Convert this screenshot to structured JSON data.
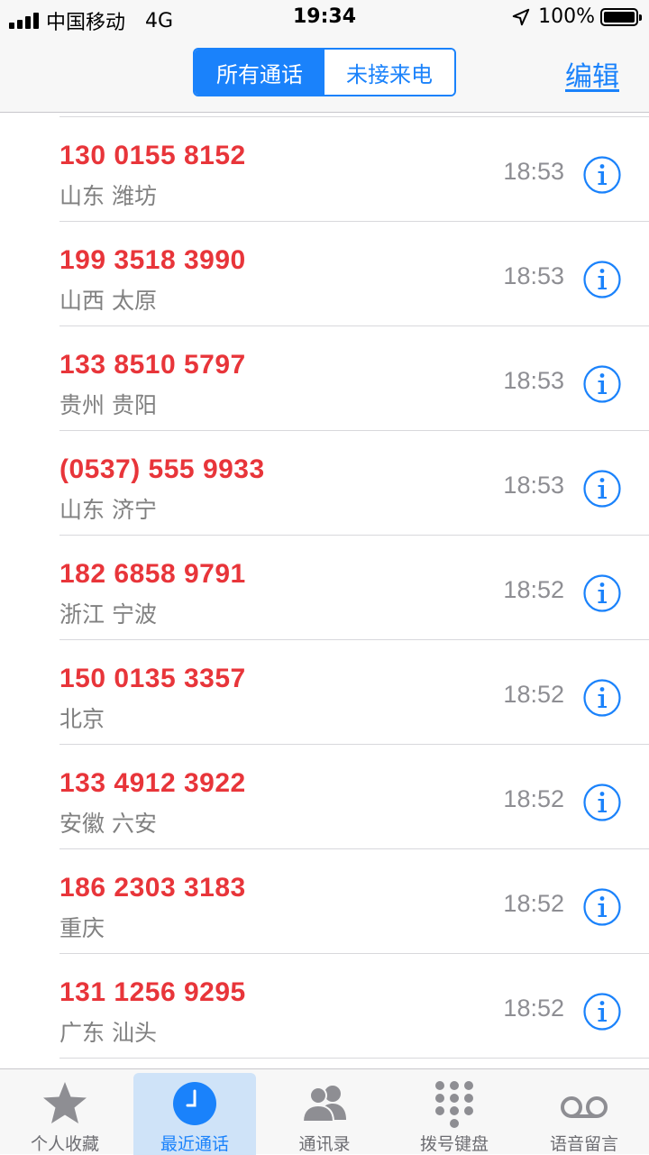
{
  "status_bar": {
    "carrier": "中国移动",
    "network": "4G",
    "time": "19:34",
    "battery": "100%"
  },
  "nav": {
    "segments": [
      "所有通话",
      "未接来电"
    ],
    "active_segment": 0,
    "edit_label": "编辑"
  },
  "calls": [
    {
      "number": "130 0155 8152",
      "location": "山东 潍坊",
      "time": "18:53"
    },
    {
      "number": "199 3518 3990",
      "location": "山西 太原",
      "time": "18:53"
    },
    {
      "number": "133 8510 5797",
      "location": "贵州 贵阳",
      "time": "18:53"
    },
    {
      "number": "(0537) 555 9933",
      "location": "山东 济宁",
      "time": "18:53"
    },
    {
      "number": "182 6858 9791",
      "location": "浙江 宁波",
      "time": "18:52"
    },
    {
      "number": "150 0135 3357",
      "location": "北京",
      "time": "18:52"
    },
    {
      "number": "133 4912 3922",
      "location": "安徽 六安",
      "time": "18:52"
    },
    {
      "number": "186 2303 3183",
      "location": "重庆",
      "time": "18:52"
    },
    {
      "number": "131 1256 9295",
      "location": "广东 汕头",
      "time": "18:52"
    }
  ],
  "tabs": [
    {
      "label": "个人收藏",
      "icon": "star-icon"
    },
    {
      "label": "最近通话",
      "icon": "clock-icon"
    },
    {
      "label": "通讯录",
      "icon": "contacts-icon"
    },
    {
      "label": "拨号键盘",
      "icon": "keypad-icon"
    },
    {
      "label": "语音留言",
      "icon": "voicemail-icon"
    }
  ],
  "selected_tab": 1,
  "colors": {
    "accent": "#1a82fb",
    "missed_call": "#e8353a",
    "secondary_text": "#8e8e93"
  }
}
